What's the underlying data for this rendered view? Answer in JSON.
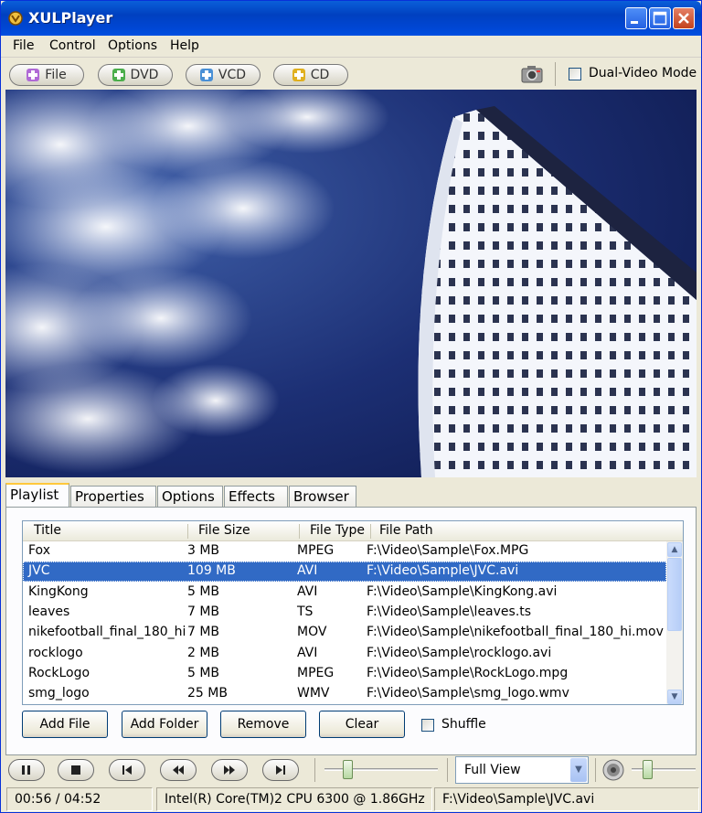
{
  "window": {
    "title": "XULPlayer"
  },
  "menu": {
    "file": "File",
    "control": "Control",
    "options": "Options",
    "help": "Help"
  },
  "toolbar": {
    "file": "File",
    "dvd": "DVD",
    "vcd": "VCD",
    "cd": "CD",
    "dual_video": "Dual-Video Mode"
  },
  "tabs": [
    "Playlist",
    "Properties",
    "Options",
    "Effects",
    "Browser"
  ],
  "playlist": {
    "columns": [
      "Title",
      "File Size",
      "File Type",
      "File Path"
    ],
    "rows": [
      [
        "Fox",
        "3 MB",
        "MPEG",
        "F:\\Video\\Sample\\Fox.MPG"
      ],
      [
        "JVC",
        "109 MB",
        "AVI",
        "F:\\Video\\Sample\\JVC.avi"
      ],
      [
        "KingKong",
        "5 MB",
        "AVI",
        "F:\\Video\\Sample\\KingKong.avi"
      ],
      [
        "leaves",
        "7 MB",
        "TS",
        "F:\\Video\\Sample\\leaves.ts"
      ],
      [
        "nikefootball_final_180_hi",
        "7 MB",
        "MOV",
        "F:\\Video\\Sample\\nikefootball_final_180_hi.mov"
      ],
      [
        "rocklogo",
        "2 MB",
        "AVI",
        "F:\\Video\\Sample\\rocklogo.avi"
      ],
      [
        "RockLogo",
        "5 MB",
        "MPEG",
        "F:\\Video\\Sample\\RockLogo.mpg"
      ],
      [
        "smg_logo",
        "25 MB",
        "WMV",
        "F:\\Video\\Sample\\smg_logo.wmv"
      ]
    ],
    "selected_index": 1
  },
  "buttons": {
    "add_file": "Add File",
    "add_folder": "Add Folder",
    "remove": "Remove",
    "clear": "Clear",
    "shuffle": "Shuffle"
  },
  "view_mode": "Full View",
  "status": {
    "time": "00:56 / 04:52",
    "cpu": "Intel(R) Core(TM)2 CPU 6300 @ 1.86GHz",
    "path": "F:\\Video\\Sample\\JVC.avi"
  },
  "colors": {
    "titlebar": "#0047d5",
    "selection": "#316ac5",
    "video_sky": "#1a2b6b"
  },
  "icons": [
    "app-icon",
    "minimize-icon",
    "maximize-icon",
    "close-icon",
    "plus-icon",
    "camera-icon",
    "pause-icon",
    "stop-icon",
    "previous-icon",
    "rewind-icon",
    "fast-forward-icon",
    "next-icon",
    "speaker-icon",
    "chevron-down-icon"
  ]
}
